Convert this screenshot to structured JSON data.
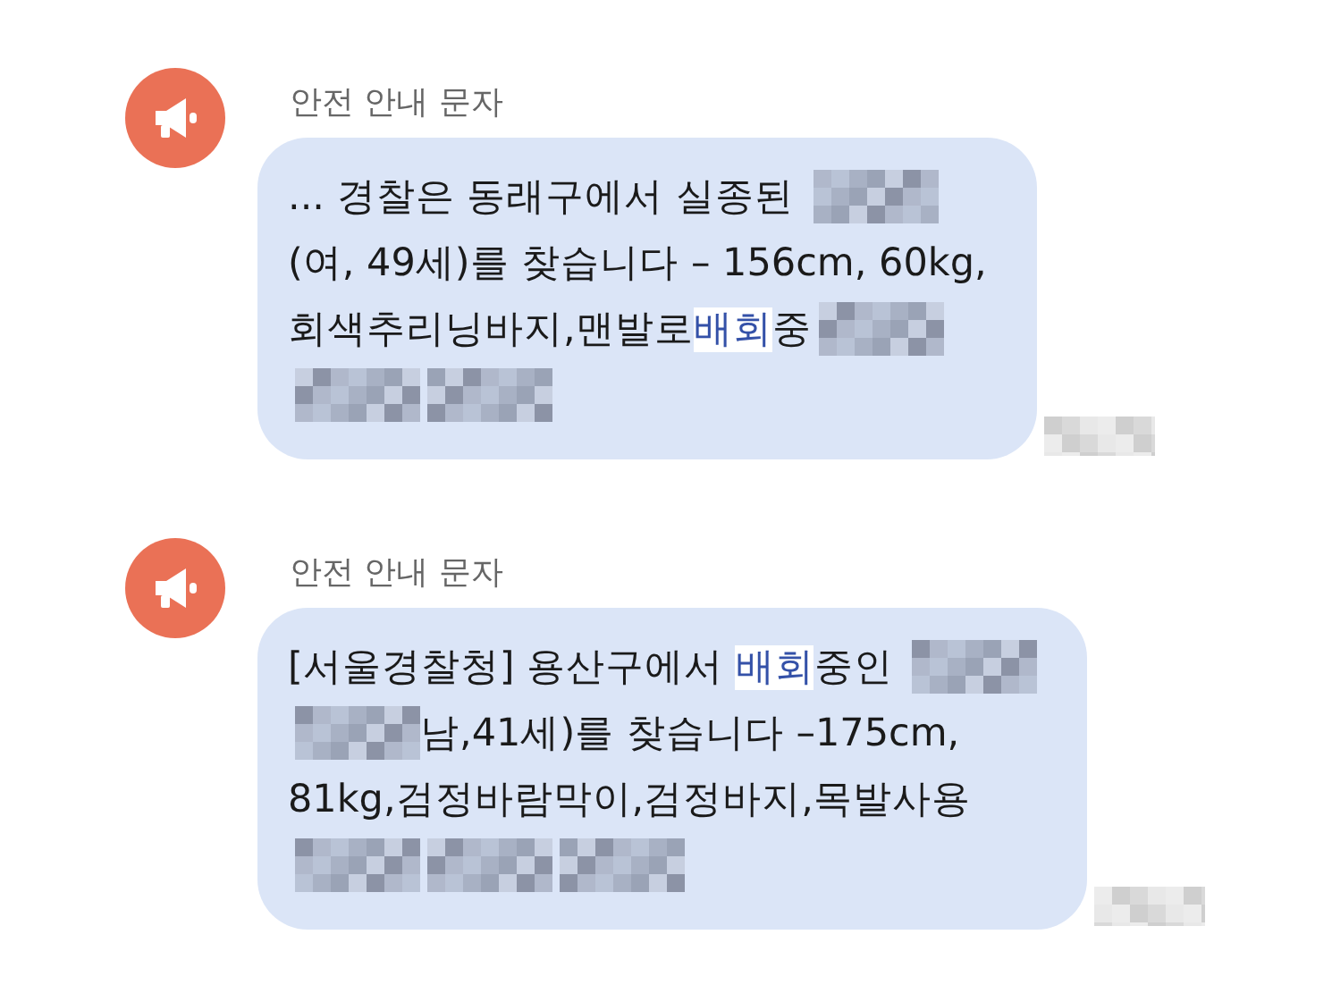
{
  "messages": [
    {
      "sender": "안전 안내 문자",
      "timestamp_redacted": true,
      "lines": [
        [
          {
            "kind": "text",
            "text": "... 경찰은 동래구에서 실종된 ",
            "highlighted": false
          },
          {
            "kind": "redacted"
          }
        ],
        [
          {
            "kind": "text",
            "text": "(여, 49세)를 찾습니다 – 156cm, 60kg,",
            "highlighted": false
          }
        ],
        [
          {
            "kind": "text",
            "text": "회색추리닝바지,맨발로",
            "highlighted": false
          },
          {
            "kind": "text",
            "text": "배회",
            "highlighted": true
          },
          {
            "kind": "text",
            "text": "중",
            "highlighted": false
          },
          {
            "kind": "redacted"
          }
        ],
        [
          {
            "kind": "redacted"
          },
          {
            "kind": "redacted"
          }
        ]
      ]
    },
    {
      "sender": "안전 안내 문자",
      "timestamp_redacted": true,
      "lines": [
        [
          {
            "kind": "text",
            "text": "[서울경찰청] 용산구에서 ",
            "highlighted": false
          },
          {
            "kind": "text",
            "text": "배회",
            "highlighted": true
          },
          {
            "kind": "text",
            "text": "중인 ",
            "highlighted": false
          },
          {
            "kind": "redacted"
          }
        ],
        [
          {
            "kind": "redacted"
          },
          {
            "kind": "text",
            "text": "남,41세)를 찾습니다 –175cm,",
            "highlighted": false
          }
        ],
        [
          {
            "kind": "text",
            "text": "81kg,검정바람막이,검정바지,목발사용",
            "highlighted": false
          }
        ],
        [
          {
            "kind": "redacted"
          },
          {
            "kind": "redacted"
          },
          {
            "kind": "redacted"
          }
        ]
      ]
    }
  ]
}
